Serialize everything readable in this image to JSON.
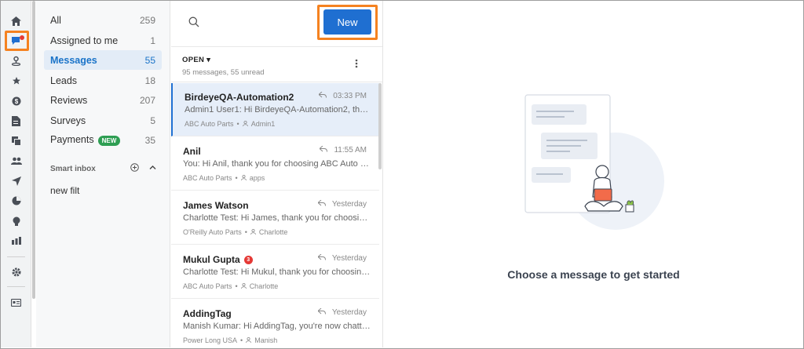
{
  "rail": {
    "items": [
      {
        "icon": "home-icon"
      },
      {
        "icon": "messages-icon"
      },
      {
        "icon": "location-pin-icon"
      },
      {
        "icon": "star-icon"
      },
      {
        "icon": "dollar-icon"
      },
      {
        "icon": "document-icon"
      },
      {
        "icon": "copy-icon"
      },
      {
        "icon": "contacts-icon"
      },
      {
        "icon": "send-icon"
      },
      {
        "icon": "pie-chart-icon"
      },
      {
        "icon": "lightbulb-icon"
      },
      {
        "icon": "bar-chart-icon"
      },
      {
        "icon": "settings-icon"
      },
      {
        "icon": "card-icon"
      }
    ]
  },
  "folders": {
    "items": [
      {
        "label": "All",
        "count": "259"
      },
      {
        "label": "Assigned to me",
        "count": "1"
      },
      {
        "label": "Messages",
        "count": "55"
      },
      {
        "label": "Leads",
        "count": "18"
      },
      {
        "label": "Reviews",
        "count": "207"
      },
      {
        "label": "Surveys",
        "count": "5"
      },
      {
        "label": "Payments",
        "count": "35",
        "badge": "NEW"
      }
    ],
    "smart_inbox_label": "Smart inbox",
    "filters": [
      "new filt"
    ]
  },
  "list": {
    "new_button": "New",
    "filter_label": "OPEN",
    "summary": "95 messages, 55 unread",
    "conversations": [
      {
        "name": "BirdeyeQA-Automation2",
        "time": "03:33 PM",
        "preview": "Admin1 User1: Hi BirdeyeQA-Automation2, thank you...",
        "location": "ABC Auto Parts",
        "assignee": "Admin1"
      },
      {
        "name": "Anil",
        "time": "11:55 AM",
        "preview": "You: Hi Anil, thank you for choosing ABC Auto Parts. ...",
        "location": "ABC Auto Parts",
        "assignee": "apps"
      },
      {
        "name": "James Watson",
        "time": "Yesterday",
        "preview": "Charlotte Test: Hi James, thank you for choosing O'R...",
        "location": "O'Reilly Auto Parts",
        "assignee": "Charlotte"
      },
      {
        "name": "Mukul Gupta",
        "time": "Yesterday",
        "preview": "Charlotte Test: Hi Mukul, thank you for choosing ABC...",
        "location": "ABC Auto Parts",
        "assignee": "Charlotte",
        "unread": "3"
      },
      {
        "name": "AddingTag",
        "time": "Yesterday",
        "preview": "Manish Kumar: Hi AddingTag, you're now chatting wi...",
        "location": "Power Long USA",
        "assignee": "Manish"
      }
    ]
  },
  "main": {
    "empty_message": "Choose a message to get started"
  },
  "colors": {
    "accent": "#1f6fd1",
    "highlight": "#f58220",
    "new_badge": "#2e9e53",
    "unread": "#e53935"
  }
}
